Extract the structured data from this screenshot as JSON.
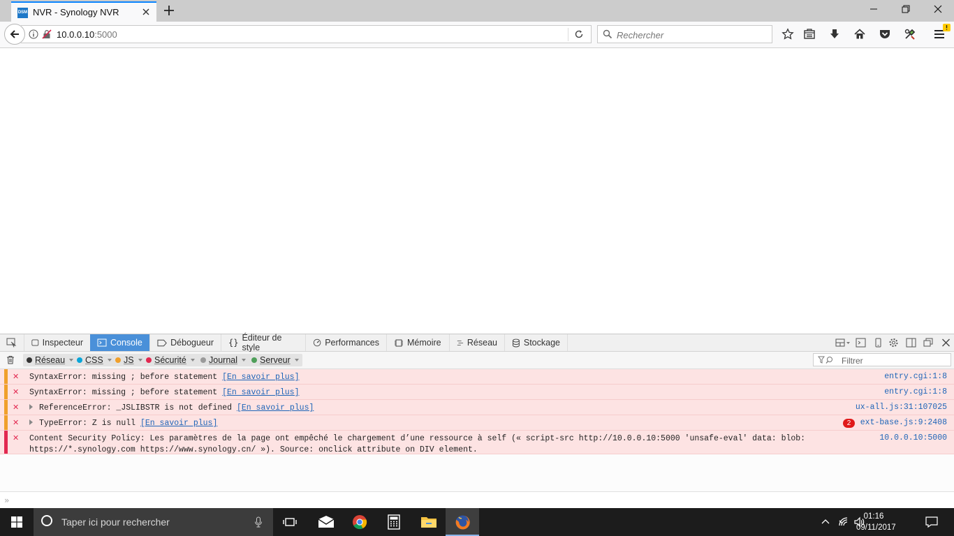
{
  "browser": {
    "tab": {
      "title": "NVR - Synology NVR",
      "favicon_text": "DSM"
    },
    "url": {
      "host": "10.0.0.10",
      "port": ":5000"
    },
    "search": {
      "placeholder": "Rechercher"
    }
  },
  "devtools": {
    "tabs": [
      {
        "label": "Inspecteur",
        "icon": "inspector-icon"
      },
      {
        "label": "Console",
        "icon": "console-icon",
        "active": true
      },
      {
        "label": "Débogueur",
        "icon": "debugger-icon"
      },
      {
        "label": "Éditeur de style",
        "icon": "style-editor-icon"
      },
      {
        "label": "Performances",
        "icon": "performance-icon"
      },
      {
        "label": "Mémoire",
        "icon": "memory-icon"
      },
      {
        "label": "Réseau",
        "icon": "network-icon"
      },
      {
        "label": "Stockage",
        "icon": "storage-icon"
      }
    ],
    "filters": [
      {
        "label": "Réseau",
        "color": "#333333"
      },
      {
        "label": "CSS",
        "color": "#0aa5d8"
      },
      {
        "label": "JS",
        "color": "#f0a02c"
      },
      {
        "label": "Sécurité",
        "color": "#e22850"
      },
      {
        "label": "Journal",
        "color": "#9a9a9a"
      },
      {
        "label": "Serveur",
        "color": "#4f9f5a"
      }
    ],
    "filter_placeholder": "Filtrer",
    "messages": [
      {
        "text": "SyntaxError: missing ; before statement",
        "link": "[En savoir plus]",
        "location": "entry.cgi:1:8",
        "severity": "warning"
      },
      {
        "text": "SyntaxError: missing ; before statement",
        "link": "[En savoir plus]",
        "location": "entry.cgi:1:8",
        "severity": "warning"
      },
      {
        "text": "ReferenceError: _JSLIBSTR is not defined",
        "link": "[En savoir plus]",
        "location": "ux-all.js:31:107025",
        "severity": "warning",
        "expandable": true
      },
      {
        "text": "TypeError: Z is null",
        "link": "[En savoir plus]",
        "location": "ext-base.js:9:2408",
        "severity": "warning",
        "expandable": true,
        "repeat": "2"
      },
      {
        "line1": "Content Security Policy: Les paramètres de la page ont empêché le chargement d’une ressource à self (« script-src http://10.0.0.10:5000 'unsafe-eval' data: blob:",
        "line2": "https://*.synology.com https://www.synology.cn/ »). Source: onclick attribute on DIV element.",
        "location": "10.0.0.10:5000",
        "severity": "error"
      }
    ]
  },
  "taskbar": {
    "search_placeholder": "Taper ici pour rechercher",
    "time": "01:16",
    "date": "09/11/2017"
  },
  "colors": {
    "accent": "#0a84ff",
    "devtools_active": "#4a90d9",
    "error_bg": "#fde3e3",
    "warning_bar": "#f0a02c",
    "error_bar": "#e22850"
  }
}
